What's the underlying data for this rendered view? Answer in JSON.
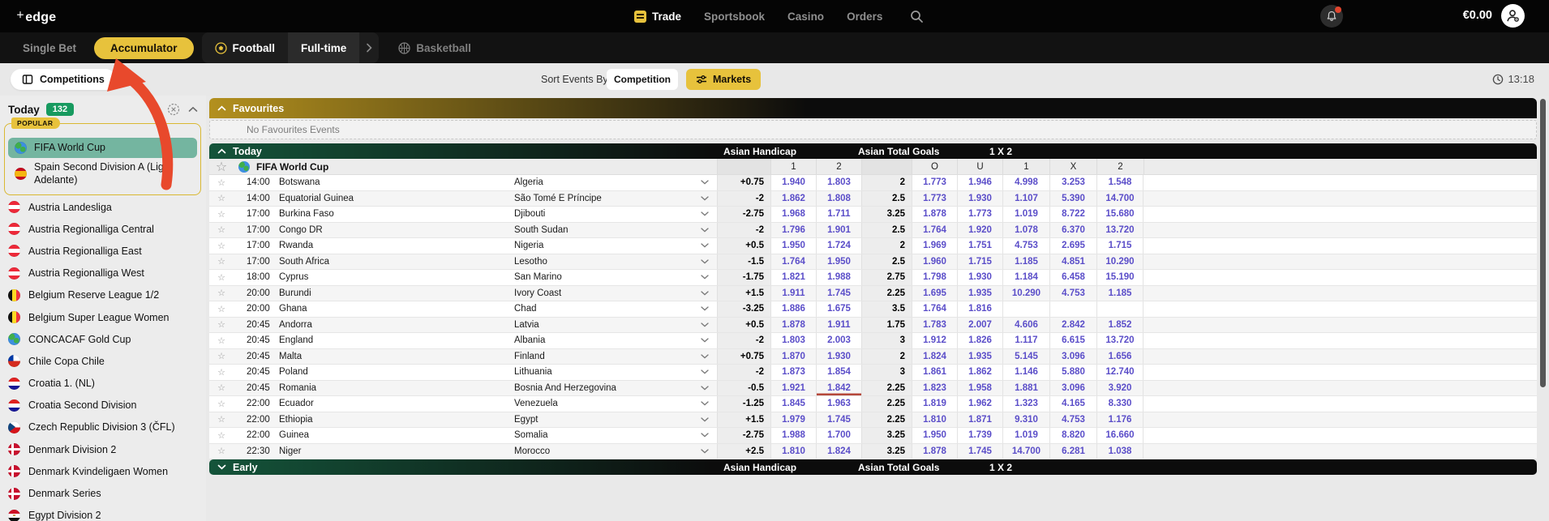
{
  "topbar": {
    "logo": "edge",
    "nav": [
      {
        "label": "Trade"
      },
      {
        "label": "Sportsbook"
      },
      {
        "label": "Casino"
      },
      {
        "label": "Orders"
      }
    ],
    "balance": "€0.00"
  },
  "subnav": {
    "single_bet": "Single Bet",
    "accumulator": "Accumulator",
    "football": "Football",
    "fulltime": "Full-time",
    "basketball": "Basketball"
  },
  "toolbar": {
    "competitions": "Competitions",
    "sort_label": "Sort Events By:",
    "sort_value": "Competition",
    "markets": "Markets",
    "clock": "13:18"
  },
  "icons": {
    "trade": "ticket",
    "search": "magnifier",
    "bell": "notification-bell",
    "avatar": "user-gear",
    "competitions": "panel",
    "markets": "sliders",
    "clock": "clock",
    "football": "soccer-ball",
    "basketball": "basketball",
    "favourite": "star-outline"
  },
  "sidebar": {
    "title": "Today",
    "count": "132",
    "popular_label": "POPULAR",
    "popular": [
      {
        "label": "FIFA World Cup",
        "flag": "globe",
        "selected": true
      },
      {
        "label": "Spain Second Division A (Liga Adelante)",
        "flag": "spain"
      }
    ],
    "items": [
      {
        "label": "Austria Landesliga",
        "flag": "austria"
      },
      {
        "label": "Austria Regionalliga Central",
        "flag": "austria"
      },
      {
        "label": "Austria Regionalliga East",
        "flag": "austria"
      },
      {
        "label": "Austria Regionalliga West",
        "flag": "austria"
      },
      {
        "label": "Belgium Reserve League 1/2",
        "flag": "belgium"
      },
      {
        "label": "Belgium Super League Women",
        "flag": "belgium"
      },
      {
        "label": "CONCACAF Gold Cup",
        "flag": "globe"
      },
      {
        "label": "Chile Copa Chile",
        "flag": "chile"
      },
      {
        "label": "Croatia 1. (NL)",
        "flag": "croatia"
      },
      {
        "label": "Croatia Second Division",
        "flag": "croatia"
      },
      {
        "label": "Czech Republic Division 3 (ČFL)",
        "flag": "czech"
      },
      {
        "label": "Denmark Division 2",
        "flag": "denmark"
      },
      {
        "label": "Denmark Kvindeligaen Women",
        "flag": "denmark"
      },
      {
        "label": "Denmark Series",
        "flag": "denmark"
      },
      {
        "label": "Egypt Division 2",
        "flag": "egypt"
      }
    ]
  },
  "main": {
    "favourites": {
      "title": "Favourites",
      "empty": "No Favourites Events"
    },
    "today_section": {
      "title": "Today",
      "columns": [
        "Asian Handicap",
        "Asian Total Goals",
        "1 X 2"
      ],
      "subcolumns": [
        "1",
        "2",
        "O",
        "U",
        "1",
        "X",
        "2"
      ]
    },
    "competition": {
      "name": "FIFA World Cup"
    },
    "events": [
      {
        "time": "14:00",
        "home": "Botswana",
        "away": "Algeria",
        "hcp_line": "+0.75",
        "hcp1": "1.940",
        "hcp2": "1.803",
        "total_line": "2",
        "over": "1.773",
        "under": "1.946",
        "h": "4.998",
        "x": "3.253",
        "a": "1.548"
      },
      {
        "time": "14:00",
        "home": "Equatorial Guinea",
        "away": "São Tomé E Príncipe",
        "hcp_line": "-2",
        "hcp1": "1.862",
        "hcp2": "1.808",
        "total_line": "2.5",
        "over": "1.773",
        "under": "1.930",
        "h": "1.107",
        "x": "5.390",
        "a": "14.700"
      },
      {
        "time": "17:00",
        "home": "Burkina Faso",
        "away": "Djibouti",
        "hcp_line": "-2.75",
        "hcp1": "1.968",
        "hcp2": "1.711",
        "total_line": "3.25",
        "over": "1.878",
        "under": "1.773",
        "h": "1.019",
        "x": "8.722",
        "a": "15.680"
      },
      {
        "time": "17:00",
        "home": "Congo DR",
        "away": "South Sudan",
        "hcp_line": "-2",
        "hcp1": "1.796",
        "hcp2": "1.901",
        "total_line": "2.5",
        "over": "1.764",
        "under": "1.920",
        "h": "1.078",
        "x": "6.370",
        "a": "13.720"
      },
      {
        "time": "17:00",
        "home": "Rwanda",
        "away": "Nigeria",
        "hcp_line": "+0.5",
        "hcp1": "1.950",
        "hcp2": "1.724",
        "total_line": "2",
        "over": "1.969",
        "under": "1.751",
        "h": "4.753",
        "x": "2.695",
        "a": "1.715"
      },
      {
        "time": "17:00",
        "home": "South Africa",
        "away": "Lesotho",
        "hcp_line": "-1.5",
        "hcp1": "1.764",
        "hcp2": "1.950",
        "total_line": "2.5",
        "over": "1.960",
        "under": "1.715",
        "h": "1.185",
        "x": "4.851",
        "a": "10.290"
      },
      {
        "time": "18:00",
        "home": "Cyprus",
        "away": "San Marino",
        "hcp_line": "-1.75",
        "hcp1": "1.821",
        "hcp2": "1.988",
        "total_line": "2.75",
        "over": "1.798",
        "under": "1.930",
        "h": "1.184",
        "x": "6.458",
        "a": "15.190"
      },
      {
        "time": "20:00",
        "home": "Burundi",
        "away": "Ivory Coast",
        "hcp_line": "+1.5",
        "hcp1": "1.911",
        "hcp2": "1.745",
        "total_line": "2.25",
        "over": "1.695",
        "under": "1.935",
        "h": "10.290",
        "x": "4.753",
        "a": "1.185"
      },
      {
        "time": "20:00",
        "home": "Ghana",
        "away": "Chad",
        "hcp_line": "-3.25",
        "hcp1": "1.886",
        "hcp2": "1.675",
        "total_line": "3.5",
        "over": "1.764",
        "under": "1.816",
        "h": "",
        "x": "",
        "a": ""
      },
      {
        "time": "20:45",
        "home": "Andorra",
        "away": "Latvia",
        "hcp_line": "+0.5",
        "hcp1": "1.878",
        "hcp2": "1.911",
        "total_line": "1.75",
        "over": "1.783",
        "under": "2.007",
        "h": "4.606",
        "x": "2.842",
        "a": "1.852"
      },
      {
        "time": "20:45",
        "home": "England",
        "away": "Albania",
        "hcp_line": "-2",
        "hcp1": "1.803",
        "hcp2": "2.003",
        "total_line": "3",
        "over": "1.912",
        "under": "1.826",
        "h": "1.117",
        "x": "6.615",
        "a": "13.720"
      },
      {
        "time": "20:45",
        "home": "Malta",
        "away": "Finland",
        "hcp_line": "+0.75",
        "hcp1": "1.870",
        "hcp2": "1.930",
        "total_line": "2",
        "over": "1.824",
        "under": "1.935",
        "h": "5.145",
        "x": "3.096",
        "a": "1.656"
      },
      {
        "time": "20:45",
        "home": "Poland",
        "away": "Lithuania",
        "hcp_line": "-2",
        "hcp1": "1.873",
        "hcp2": "1.854",
        "total_line": "3",
        "over": "1.861",
        "under": "1.862",
        "h": "1.146",
        "x": "5.880",
        "a": "12.740"
      },
      {
        "time": "20:45",
        "home": "Romania",
        "away": "Bosnia And Herzegovina",
        "hcp_line": "-0.5",
        "hcp1": "1.921",
        "hcp2": "1.842",
        "hcp2_hl": true,
        "total_line": "2.25",
        "over": "1.823",
        "under": "1.958",
        "h": "1.881",
        "x": "3.096",
        "a": "3.920"
      },
      {
        "time": "22:00",
        "home": "Ecuador",
        "away": "Venezuela",
        "hcp_line": "-1.25",
        "hcp1": "1.845",
        "hcp2": "1.963",
        "total_line": "2.25",
        "over": "1.819",
        "under": "1.962",
        "h": "1.323",
        "x": "4.165",
        "a": "8.330"
      },
      {
        "time": "22:00",
        "home": "Ethiopia",
        "away": "Egypt",
        "hcp_line": "+1.5",
        "hcp1": "1.979",
        "hcp2": "1.745",
        "total_line": "2.25",
        "over": "1.810",
        "under": "1.871",
        "h": "9.310",
        "x": "4.753",
        "a": "1.176"
      },
      {
        "time": "22:00",
        "home": "Guinea",
        "away": "Somalia",
        "hcp_line": "-2.75",
        "hcp1": "1.988",
        "hcp2": "1.700",
        "total_line": "3.25",
        "over": "1.950",
        "under": "1.739",
        "h": "1.019",
        "x": "8.820",
        "a": "16.660"
      },
      {
        "time": "22:30",
        "home": "Niger",
        "away": "Morocco",
        "hcp_line": "+2.5",
        "hcp1": "1.810",
        "hcp2": "1.824",
        "total_line": "3.25",
        "over": "1.878",
        "under": "1.745",
        "h": "14.700",
        "x": "6.281",
        "a": "1.038"
      }
    ],
    "early_section": {
      "title": "Early",
      "columns": [
        "Asian Handicap",
        "Asian Total Goals",
        "1 X 2"
      ]
    }
  },
  "colors": {
    "accent_yellow": "#e7c23c",
    "odds_purple": "#5b4ec9",
    "selected_teal": "#74b5a0",
    "badge_green": "#179a5f",
    "annotation_red": "#e8492c"
  }
}
